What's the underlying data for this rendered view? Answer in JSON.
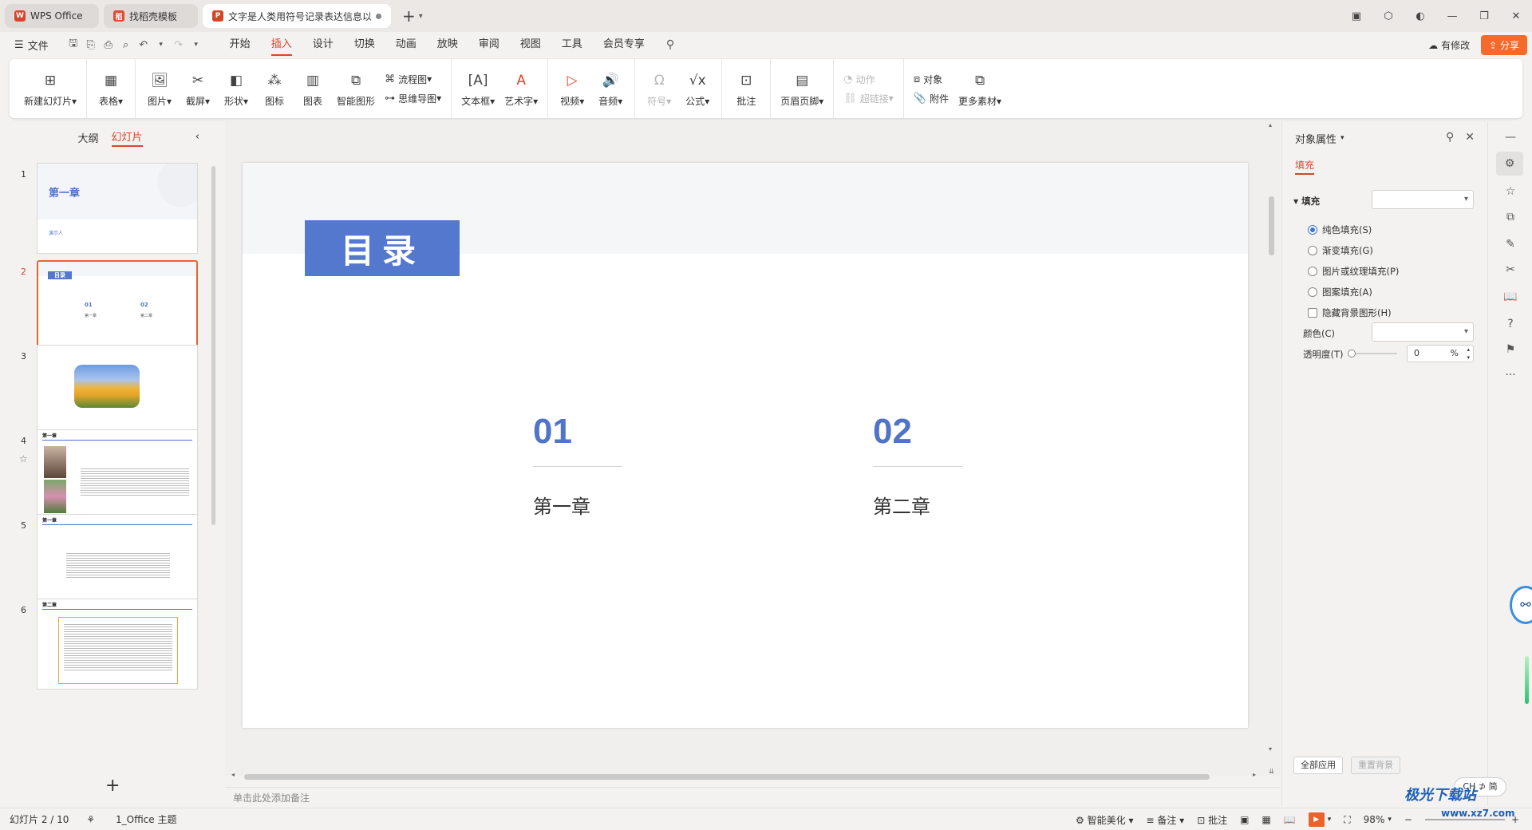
{
  "tabs": [
    {
      "label": "WPS Office",
      "icon": "wps-logo-icon",
      "color": "#d9452c"
    },
    {
      "label": "找稻壳模板",
      "icon": "docer-icon",
      "color": "#e04a2f"
    },
    {
      "label": "文字是人类用符号记录表达信息以",
      "icon": "ppt-file-icon",
      "color": "#d24726"
    }
  ],
  "menubar": {
    "file_label": "文件",
    "menus": [
      "开始",
      "插入",
      "设计",
      "切换",
      "动画",
      "放映",
      "审阅",
      "视图",
      "工具",
      "会员专享"
    ],
    "active_menu": "插入",
    "revise_label": "有修改",
    "share_label": "分享"
  },
  "ribbon": {
    "new_slide": "新建幻灯片",
    "table": "表格",
    "picture": "图片",
    "screenshot": "截屏",
    "shape": "形状",
    "icon": "图标",
    "chart": "图表",
    "smart_art": "智能图形",
    "flowchart": "流程图",
    "mindmap": "思维导图",
    "textbox": "文本框",
    "wordart": "艺术字",
    "video": "视频",
    "audio": "音频",
    "symbol": "符号",
    "formula": "公式",
    "comment": "批注",
    "header_footer": "页眉页脚",
    "action": "动作",
    "hyperlink": "超链接",
    "object": "对象",
    "attachment": "附件",
    "more_assets": "更多素材"
  },
  "left_panel": {
    "tab_outline": "大纲",
    "tab_slides": "幻灯片",
    "thumbnails": [
      {
        "num": "1",
        "title": "第一章",
        "sub": "演示人"
      },
      {
        "num": "2",
        "title": "目录",
        "items": [
          "01",
          "02"
        ],
        "labels": [
          "第一章",
          "第二章"
        ]
      },
      {
        "num": "3"
      },
      {
        "num": "4",
        "title": "第一章"
      },
      {
        "num": "5",
        "title": "第一章"
      },
      {
        "num": "6",
        "title": "第二章"
      }
    ]
  },
  "slide": {
    "title": "目录",
    "items": [
      {
        "num": "01",
        "label": "第一章"
      },
      {
        "num": "02",
        "label": "第二章"
      }
    ],
    "accent_color": "#5578cf",
    "number_color": "#4f74c8"
  },
  "notes_placeholder": "单击此处添加备注",
  "props": {
    "title": "对象属性",
    "subtab": "填充",
    "fill_section": "填充",
    "options": [
      "纯色填充(S)",
      "渐变填充(G)",
      "图片或纹理填充(P)",
      "图案填充(A)"
    ],
    "selected_option": "纯色填充(S)",
    "hide_bg_label": "隐藏背景图形(H)",
    "color_label": "颜色(C)",
    "transparency_label": "透明度(T)",
    "transparency_value": "0",
    "percent": "%",
    "apply_all": "全部应用",
    "reset_bg": "重置背景"
  },
  "ime_label": "CH ⊅ 简",
  "statusbar": {
    "slide_info": "幻灯片 2 / 10",
    "theme": "1_Office 主题",
    "smart_beautify": "智能美化",
    "notes": "备注",
    "comments": "批注",
    "zoom": "98%"
  },
  "watermark": {
    "main": "极光下载站",
    "sub": "www.xz7.com"
  }
}
